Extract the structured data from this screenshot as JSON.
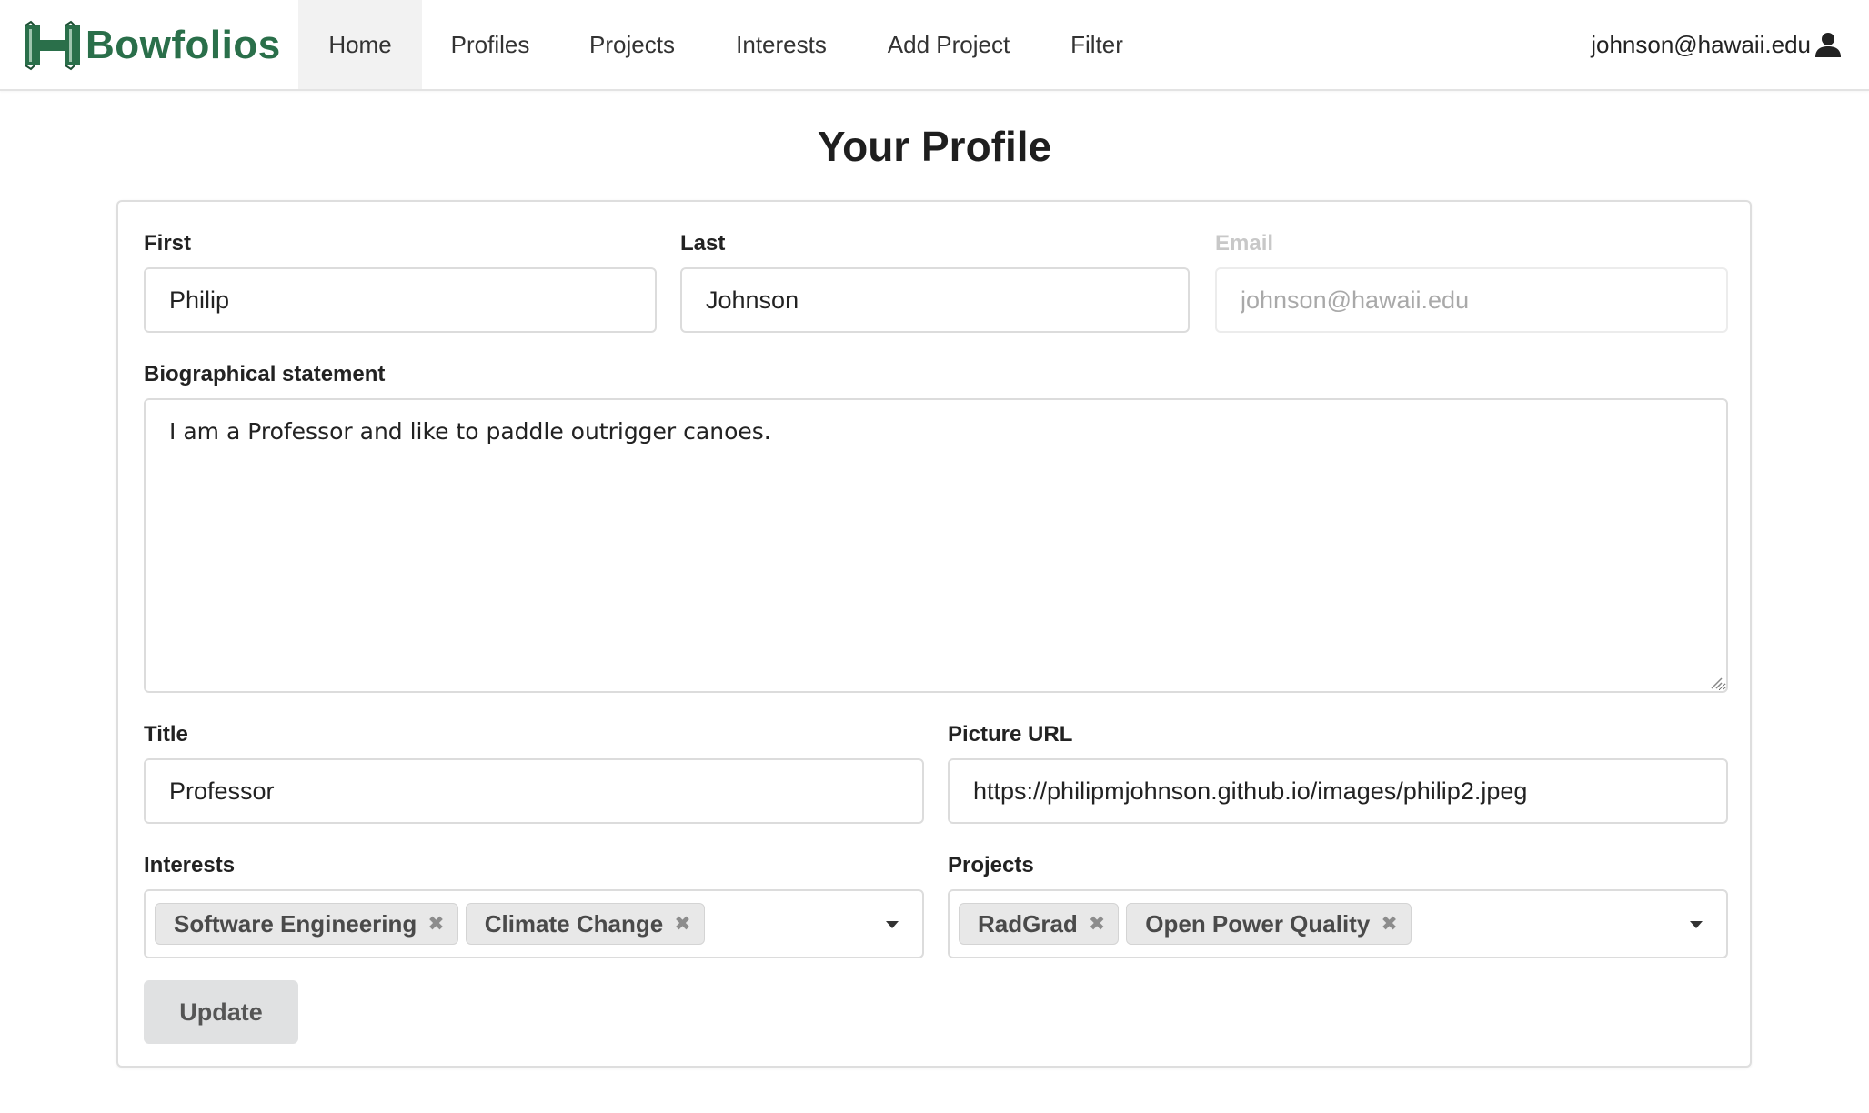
{
  "navbar": {
    "brand": "Bowfolios",
    "items": [
      {
        "label": "Home",
        "active": true
      },
      {
        "label": "Profiles",
        "active": false
      },
      {
        "label": "Projects",
        "active": false
      },
      {
        "label": "Interests",
        "active": false
      },
      {
        "label": "Add Project",
        "active": false
      },
      {
        "label": "Filter",
        "active": false
      }
    ],
    "user_email": "johnson@hawaii.edu",
    "user_icon": "user-icon"
  },
  "page": {
    "title": "Your Profile"
  },
  "form": {
    "first": {
      "label": "First",
      "value": "Philip"
    },
    "last": {
      "label": "Last",
      "value": "Johnson"
    },
    "email": {
      "label": "Email",
      "value": "johnson@hawaii.edu",
      "disabled": true
    },
    "bio": {
      "label": "Biographical statement",
      "value": "I am a Professor and like to paddle outrigger canoes."
    },
    "title": {
      "label": "Title",
      "value": "Professor"
    },
    "picture": {
      "label": "Picture URL",
      "value": "https://philipmjohnson.github.io/images/philip2.jpeg"
    },
    "interests": {
      "label": "Interests",
      "selected": [
        "Software Engineering",
        "Climate Change"
      ]
    },
    "projects": {
      "label": "Projects",
      "selected": [
        "RadGrad",
        "Open Power Quality"
      ]
    },
    "submit_label": "Update"
  },
  "colors": {
    "brand_green": "#2a6f4a",
    "active_nav_bg": "#f2f2f2",
    "button_bg": "#e0e1e2",
    "chip_bg": "#e8e8e8"
  }
}
